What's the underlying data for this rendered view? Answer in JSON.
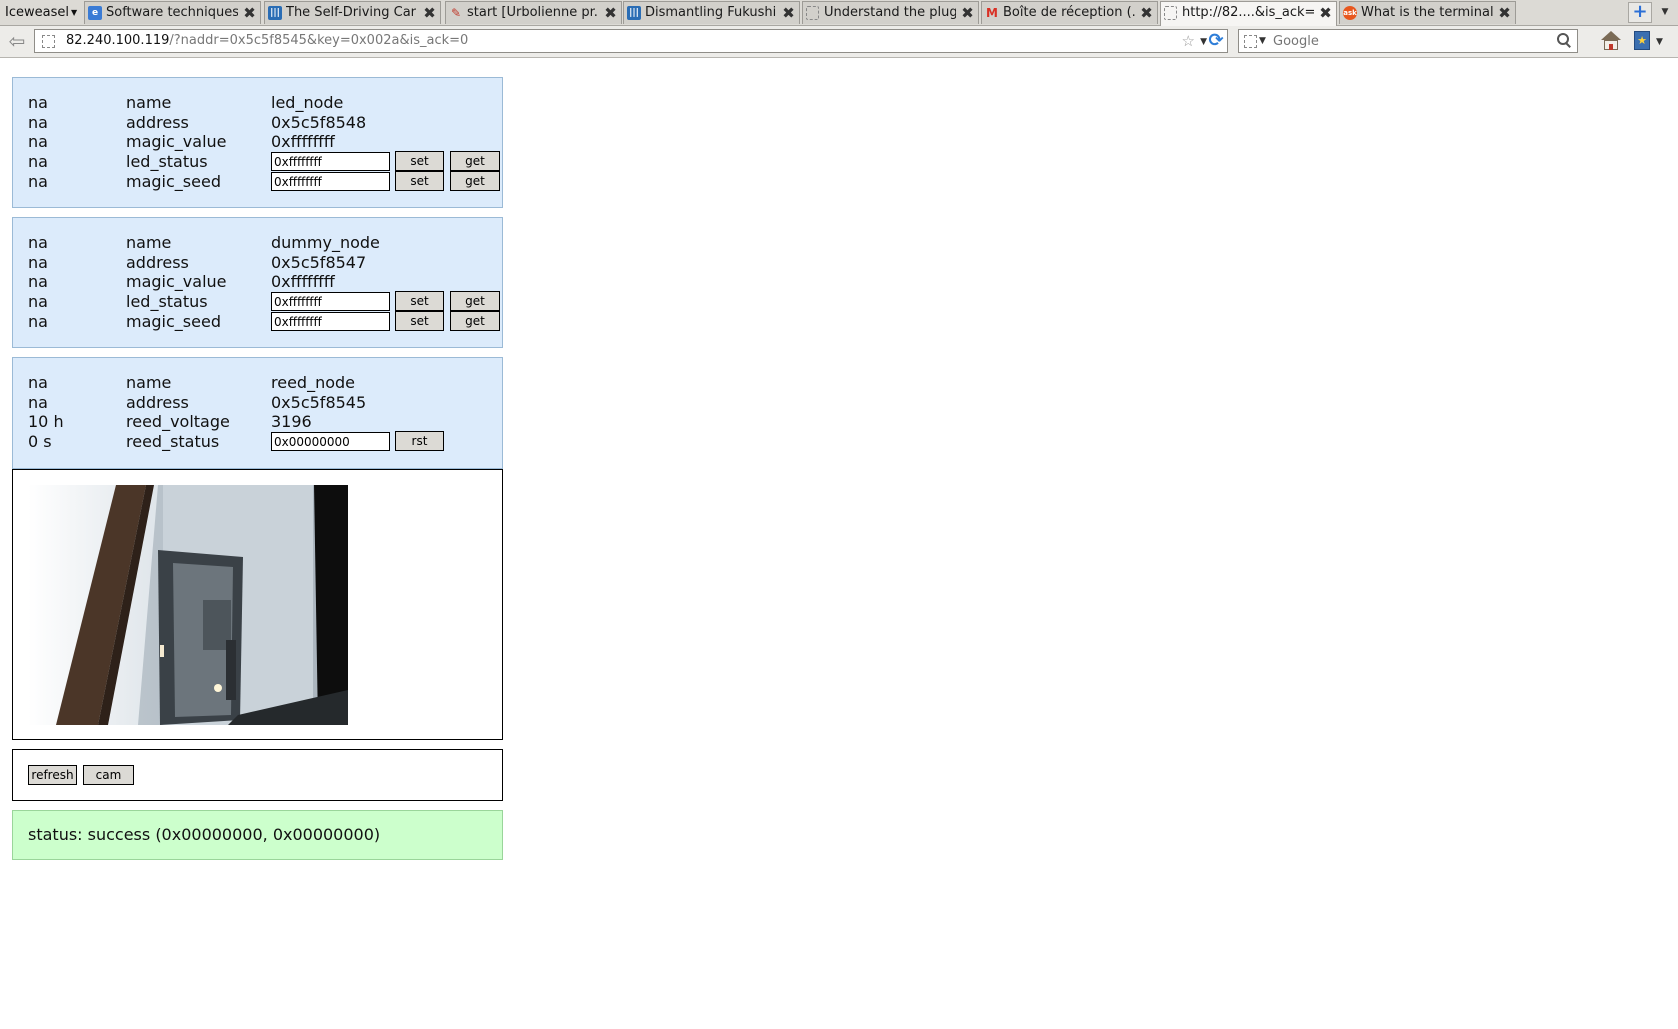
{
  "browser": {
    "app_menu": "Iceweasel",
    "tabs": [
      {
        "title": "Software techniques...",
        "favicon": "browser-page-icon",
        "color": "#3a7bd5",
        "active": false
      },
      {
        "title": "The Self-Driving Car ...",
        "favicon": "site-logo-icon",
        "color": "#2a6db5",
        "active": false
      },
      {
        "title": "start [Urbolienne pr...",
        "favicon": "wiki-pencil-icon",
        "color": "#c0392b",
        "active": false
      },
      {
        "title": "Dismantling Fukushi...",
        "favicon": "site-logo-icon",
        "color": "#2a6db5",
        "active": false
      },
      {
        "title": "Understand the plug...",
        "favicon": "blank-page-icon",
        "color": "#ffffff",
        "active": false
      },
      {
        "title": "Boîte de réception (...",
        "favicon": "gmail-icon",
        "color": "#d93025",
        "active": false
      },
      {
        "title": "http://82....&is_ack=0",
        "favicon": "blank-page-icon",
        "color": "#ffffff",
        "active": true
      },
      {
        "title": "What is the terminal...",
        "favicon": "askubuntu-icon",
        "color": "#e8571e",
        "active": false
      }
    ],
    "url_host": "82.240.100.119",
    "url_rest": "/?naddr=0x5c5f8545&key=0x002a&is_ack=0",
    "search_placeholder": "Google"
  },
  "nodes": [
    {
      "rows": [
        {
          "c1": "na",
          "c2": "name",
          "c3": "led_node"
        },
        {
          "c1": "na",
          "c2": "address",
          "c3": "0x5c5f8548"
        },
        {
          "c1": "na",
          "c2": "magic_value",
          "c3": "0xffffffff"
        },
        {
          "c1": "na",
          "c2": "led_status",
          "input": "0xffffffff",
          "set": "set",
          "get": "get"
        },
        {
          "c1": "na",
          "c2": "magic_seed",
          "input": "0xffffffff",
          "set": "set",
          "get": "get"
        }
      ]
    },
    {
      "rows": [
        {
          "c1": "na",
          "c2": "name",
          "c3": "dummy_node"
        },
        {
          "c1": "na",
          "c2": "address",
          "c3": "0x5c5f8547"
        },
        {
          "c1": "na",
          "c2": "magic_value",
          "c3": "0xffffffff"
        },
        {
          "c1": "na",
          "c2": "led_status",
          "input": "0xffffffff",
          "set": "set",
          "get": "get"
        },
        {
          "c1": "na",
          "c2": "magic_seed",
          "input": "0xffffffff",
          "set": "set",
          "get": "get"
        }
      ]
    },
    {
      "rows": [
        {
          "c1": "na",
          "c2": "name",
          "c3": "reed_node"
        },
        {
          "c1": "na",
          "c2": "address",
          "c3": "0x5c5f8545"
        },
        {
          "c1": "10 h",
          "c2": "reed_voltage",
          "c3": "3196"
        },
        {
          "c1": "0 s",
          "c2": "reed_status",
          "input": "0x00000000",
          "rst": "rst"
        }
      ]
    }
  ],
  "controls": {
    "refresh": "refresh",
    "cam": "cam"
  },
  "status": "status: success (0x00000000, 0x00000000)",
  "colors": {
    "panel_bg": "#dcebfb",
    "status_bg": "#ccffcc"
  }
}
